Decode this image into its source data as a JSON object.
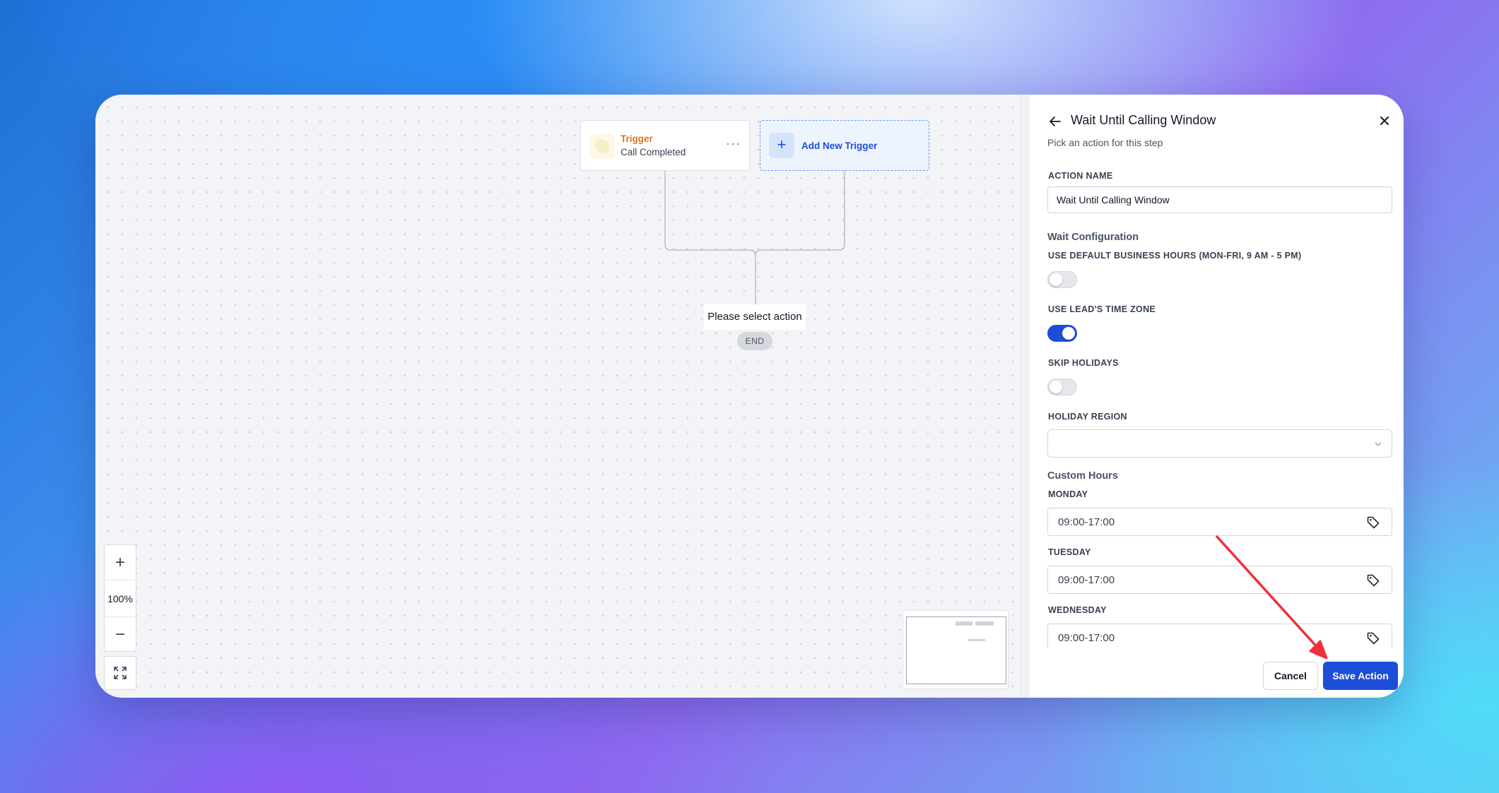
{
  "canvas": {
    "trigger_node": {
      "title": "Trigger",
      "subtitle": "Call Completed",
      "menu": "···"
    },
    "add_trigger": {
      "label": "Add New Trigger",
      "icon": "plus-icon"
    },
    "placeholder_action": "Please select action",
    "end_label": "END",
    "zoom": {
      "in_symbol": "+",
      "level": "100%",
      "out_symbol": "−"
    }
  },
  "panel": {
    "title": "Wait Until Calling Window",
    "subtitle": "Pick an action for this step",
    "action_name_label": "ACTION NAME",
    "action_name_value": "Wait Until Calling Window",
    "wait_config_heading": "Wait Configuration",
    "default_hours_label": "USE DEFAULT BUSINESS HOURS (MON-FRI, 9 AM - 5 PM)",
    "default_hours_on": false,
    "lead_tz_label": "USE LEAD'S TIME ZONE",
    "lead_tz_on": true,
    "skip_holidays_label": "SKIP HOLIDAYS",
    "skip_holidays_on": false,
    "holiday_region_label": "HOLIDAY REGION",
    "holiday_region_value": "",
    "custom_hours_heading": "Custom Hours",
    "days": [
      {
        "label": "MONDAY",
        "value": "09:00-17:00"
      },
      {
        "label": "TUESDAY",
        "value": "09:00-17:00"
      },
      {
        "label": "WEDNESDAY",
        "value": "09:00-17:00"
      }
    ]
  },
  "footer": {
    "cancel_label": "Cancel",
    "save_label": "Save Action"
  },
  "colors": {
    "accent": "#1d4ed8",
    "trigger": "#e0761a",
    "annotation_arrow": "#f0303f"
  }
}
